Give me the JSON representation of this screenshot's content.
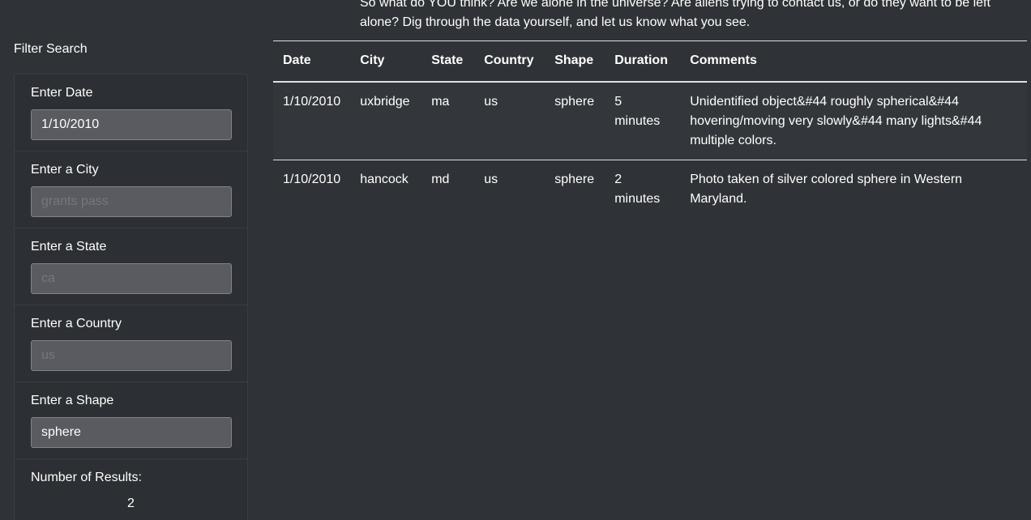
{
  "intro": {
    "line1": "So what do YOU think? Are we alone in the universe? Are aliens trying to contact us, or do they want to be left",
    "line2": "alone? Dig through the data yourself, and let us know what you see."
  },
  "sidebar": {
    "title": "Filter Search",
    "filters": [
      {
        "label": "Enter Date",
        "value": "1/10/2010",
        "placeholder": ""
      },
      {
        "label": "Enter a City",
        "value": "",
        "placeholder": "grants pass"
      },
      {
        "label": "Enter a State",
        "value": "",
        "placeholder": "ca"
      },
      {
        "label": "Enter a Country",
        "value": "",
        "placeholder": "us"
      },
      {
        "label": "Enter a Shape",
        "value": "sphere",
        "placeholder": ""
      }
    ],
    "results_label": "Number of Results:",
    "results_count": "2"
  },
  "table": {
    "headers": [
      "Date",
      "City",
      "State",
      "Country",
      "Shape",
      "Duration",
      "Comments"
    ],
    "rows": [
      {
        "date": "1/10/2010",
        "city": "uxbridge",
        "state": "ma",
        "country": "us",
        "shape": "sphere",
        "duration": "5 minutes",
        "comments": "Unidentified object&#44 roughly spherical&#44 hovering/moving very slowly&#44 many lights&#44 multiple colors."
      },
      {
        "date": "1/10/2010",
        "city": "hancock",
        "state": "md",
        "country": "us",
        "shape": "sphere",
        "duration": "2 minutes",
        "comments": "Photo taken of silver colored sphere in Western Maryland."
      }
    ]
  }
}
